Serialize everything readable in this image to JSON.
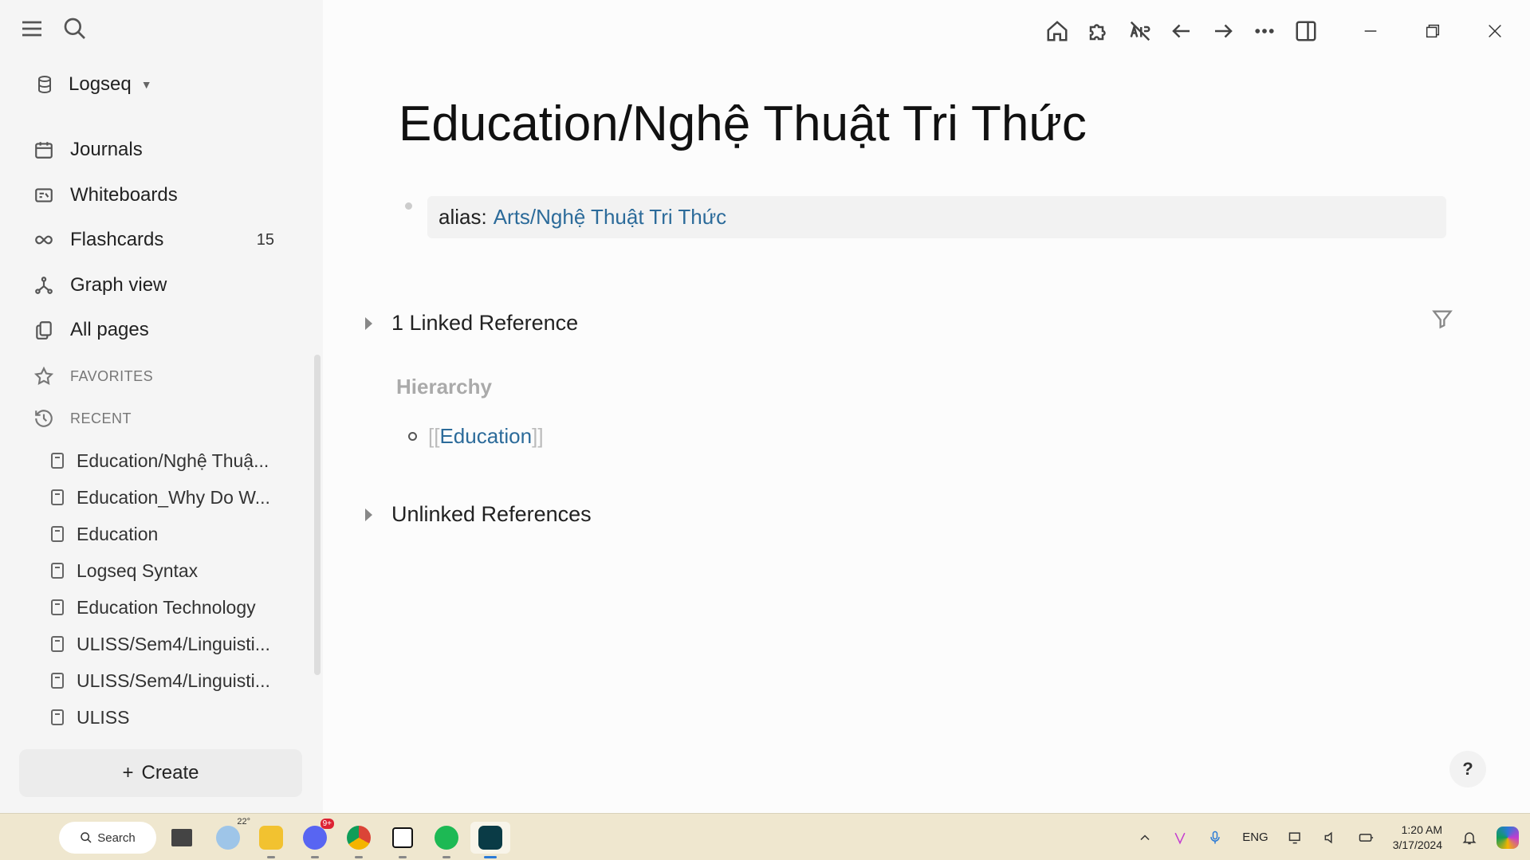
{
  "sidebar": {
    "graph_name": "Logseq",
    "nav": [
      {
        "label": "Journals",
        "icon": "calendar-icon"
      },
      {
        "label": "Whiteboards",
        "icon": "whiteboard-icon"
      },
      {
        "label": "Flashcards",
        "icon": "infinity-icon",
        "count": "15"
      },
      {
        "label": "Graph view",
        "icon": "graph-icon"
      },
      {
        "label": "All pages",
        "icon": "pages-icon"
      }
    ],
    "favorites_label": "FAVORITES",
    "recent_label": "RECENT",
    "recent": [
      "Education/Nghệ Thuậ...",
      "Education_Why Do W...",
      "Education",
      "Logseq Syntax",
      "Education Technology",
      "ULISS/Sem4/Linguisti...",
      "ULISS/Sem4/Linguisti...",
      "ULISS"
    ],
    "create_label": "Create"
  },
  "page": {
    "title": "Education/Nghệ Thuật Tri Thức",
    "property_key": "alias:",
    "property_value": "Arts/Nghệ Thuật Tri Thức",
    "linked_refs": "1 Linked Reference",
    "hierarchy_label": "Hierarchy",
    "hierarchy_open": "[[",
    "hierarchy_item": "Education",
    "hierarchy_close": "]]",
    "unlinked_refs": "Unlinked References",
    "help": "?"
  },
  "taskbar": {
    "search_label": "Search",
    "weather_temp": "22°",
    "discord_badge": "9+",
    "lang": "ENG",
    "time": "1:20 AM",
    "date": "3/17/2024"
  },
  "colors": {
    "link": "#2c6b9a",
    "sidebar_bg": "#f5f5f5",
    "taskbar_bg": "#efe7cf"
  }
}
